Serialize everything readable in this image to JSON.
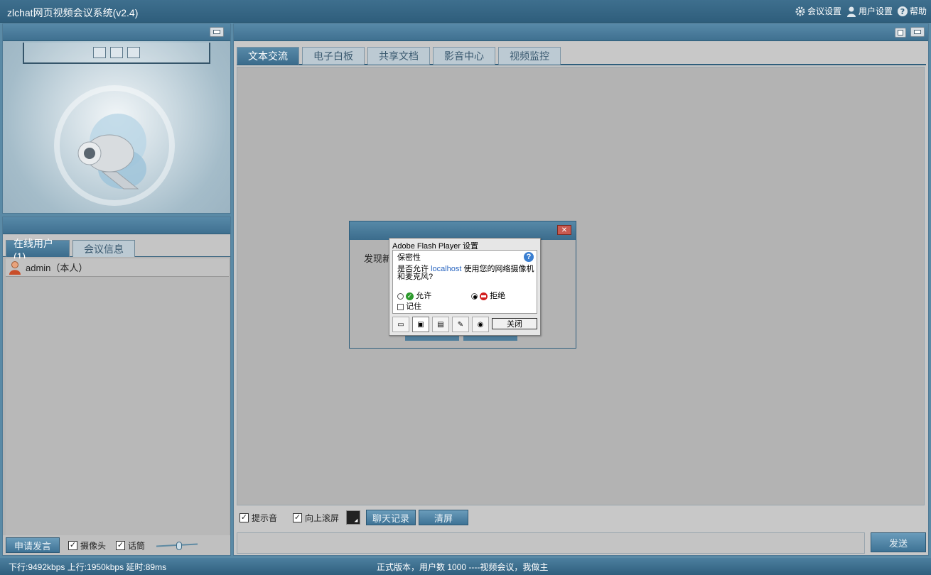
{
  "app": {
    "title": "zlchat网页视频会议系统(v2.4)"
  },
  "top_actions": [
    {
      "icon": "gear-icon",
      "label": "会议设置"
    },
    {
      "icon": "user-icon",
      "label": "用户设置"
    },
    {
      "icon": "help-icon",
      "label": "帮助"
    }
  ],
  "users_panel": {
    "tabs": [
      "在线用户(1)",
      "会议信息"
    ],
    "users": [
      {
        "name": "admin（本人）"
      }
    ],
    "bottom": {
      "request_btn": "申请发言",
      "camera_label": "摄像头",
      "mic_label": "话筒"
    }
  },
  "main_panel": {
    "tabs": [
      "文本交流",
      "电子白板",
      "共享文档",
      "影音中心",
      "视频监控"
    ],
    "tools": {
      "sound_label": "提示音",
      "scroll_label": "向上滚屏",
      "history_btn": "聊天记录",
      "clear_btn": "清屏"
    },
    "send_btn": "发送"
  },
  "dialog": {
    "text": "发现新"
  },
  "flash": {
    "title": "Adobe Flash Player 设置",
    "section": "保密性",
    "q1": "是否允许",
    "host": "localhost",
    "q2": "使用您的网络摄像机",
    "q3": "和麦克风?",
    "allow": "允许",
    "deny": "拒绝",
    "remember": "记住",
    "close": "关闭"
  },
  "status": {
    "left": "下行:9492kbps  上行:1950kbps  延时:89ms",
    "center": "正式版本，用户数 1000 ----视频会议，我做主"
  }
}
